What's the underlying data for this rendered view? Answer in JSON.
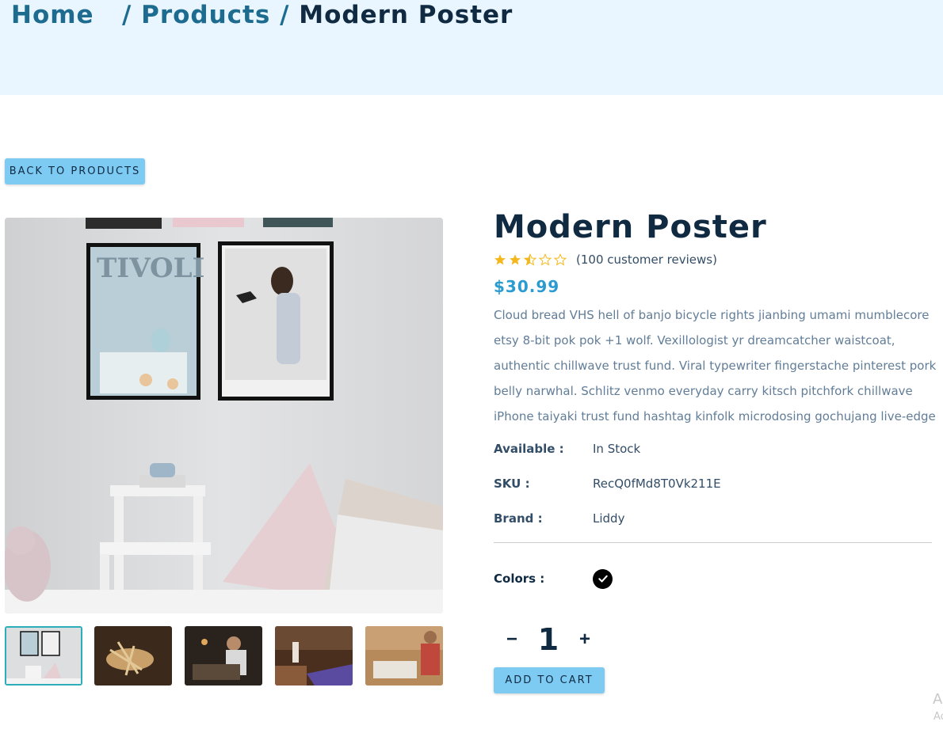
{
  "breadcrumb": {
    "home": "Home",
    "sep1": "/",
    "products": "Products",
    "sep2": "/",
    "current": "Modern Poster"
  },
  "back_button": "BACK TO PRODUCTS",
  "product": {
    "title": "Modern Poster",
    "rating": 2.5,
    "rating_max": 5,
    "reviews": "(100 customer reviews)",
    "price": "$30.99",
    "description": "Cloud bread VHS hell of banjo bicycle rights jianbing umami mumblecore etsy 8-bit pok pok +1 wolf. Vexillologist yr dreamcatcher waistcoat, authentic chillwave trust fund. Viral typewriter fingerstache pinterest pork belly narwhal. Schlitz venmo everyday carry kitsch pitchfork chillwave iPhone taiyaki trust fund hashtag kinfolk microdosing gochujang live-edge",
    "available_label": "Available :",
    "available_value": "In Stock",
    "sku_label": "SKU :",
    "sku_value": "RecQ0fMd8T0Vk211E",
    "brand_label": "Brand :",
    "brand_value": "Liddy",
    "colors_label": "Colors :",
    "color_selected": "#000000"
  },
  "quantity": {
    "minus": "−",
    "value": "1",
    "plus": "+"
  },
  "add_to_cart": "ADD TO CART",
  "watermark": {
    "line1": "A",
    "line2": "Ac"
  },
  "colors": {
    "star": "#f5b81c",
    "accent": "#7dcbf3",
    "price": "#2b9bd0",
    "hero_bg": "#eaf6ff",
    "active_thumb_border": "#2caeba"
  }
}
